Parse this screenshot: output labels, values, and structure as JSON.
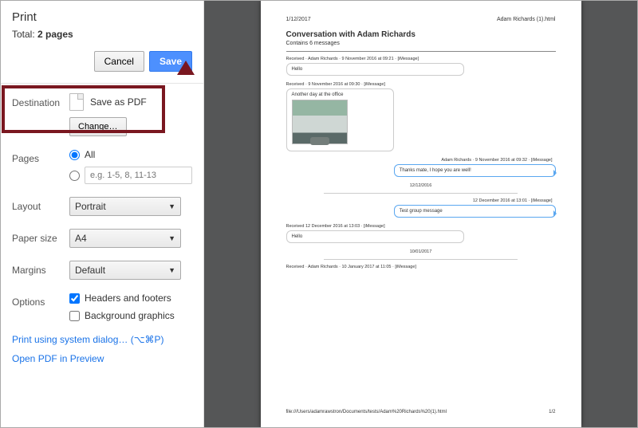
{
  "sidebar": {
    "title": "Print",
    "total_label": "Total:",
    "total_value": "2 pages",
    "cancel_label": "Cancel",
    "save_label": "Save",
    "destination": {
      "label": "Destination",
      "value": "Save as PDF",
      "change_label": "Change…"
    },
    "pages": {
      "label": "Pages",
      "all_label": "All",
      "custom_placeholder": "e.g. 1-5, 8, 11-13"
    },
    "layout": {
      "label": "Layout",
      "value": "Portrait"
    },
    "paper_size": {
      "label": "Paper size",
      "value": "A4"
    },
    "margins": {
      "label": "Margins",
      "value": "Default"
    },
    "options": {
      "label": "Options",
      "headers_label": "Headers and footers",
      "bg_label": "Background graphics"
    },
    "system_dialog_link": "Print using system dialog… (⌥⌘P)",
    "open_pdf_link": "Open PDF in Preview"
  },
  "preview": {
    "header_left": "1/12/2017",
    "header_right": "Adam Richards (1).html",
    "title": "Conversation with Adam Richards",
    "subtitle": "Contains 6 messages",
    "msg1_meta": "Received · Adam Richards · 9 November 2016 at 09:21 · [iMessage]",
    "msg1_body": "Hello",
    "msg2_meta": "Received · 9 November 2016 at 09:30 · [iMessage]",
    "msg2_body": "Another day at the office",
    "msg3_meta": "Adam Richards · 9 November 2016 at 09:32 · [iMessage]",
    "msg3_body": "Thanks mate, I hope you are well!",
    "date1": "12/12/2016",
    "msg4_meta": "12 December 2016 at 13:01 · [iMessage]",
    "msg4_body": "Test group message",
    "msg5_meta": "Received 12 December 2016 at 13:03 · [iMessage]",
    "msg5_body": "Hello",
    "date2": "10/01/2017",
    "msg6_meta": "Received · Adam Richards · 10 January 2017 at 11:05 · [iMessage]",
    "footer_left": "file:///Users/adamrawstron/Documents/tests/Adam%20Richards%20(1).html",
    "footer_right": "1/2"
  }
}
